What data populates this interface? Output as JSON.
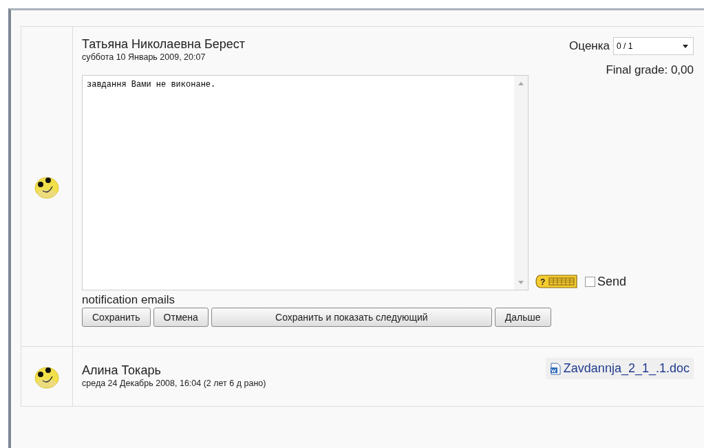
{
  "submissions": [
    {
      "kind": "graded",
      "name": "Татьяна Николаевна Берест",
      "date": "суббота 10 Январь 2009, 20:07",
      "feedback": "завдання Вами не виконане.",
      "grade_label": "Оценка",
      "grade_value": "0 / 1",
      "final_grade": "Final grade: 0,00",
      "help_mark": "?",
      "send_label": "Send",
      "send_checked": false,
      "notification": "notification emails",
      "buttons": [
        "Сохранить",
        "Отмена",
        "Сохранить и показать следующий",
        "Дальше"
      ]
    },
    {
      "kind": "file",
      "name": "Алина Токарь",
      "date": "среда 24 Декабрь 2008, 16:04 (2 лет 6 д рано)",
      "file": "Zavdannja_2_1_.1.doc"
    }
  ]
}
